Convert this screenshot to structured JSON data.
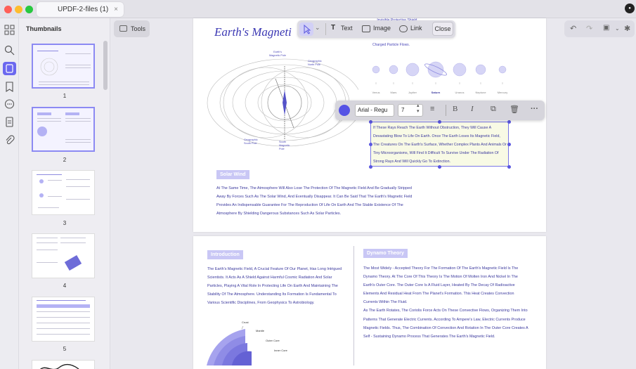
{
  "window": {
    "tab_title": "UPDF-2-files (1)",
    "tab_close": "×",
    "account_initial": "●"
  },
  "thumbnails": {
    "title": "Thumbnails",
    "pages": [
      "1",
      "2",
      "3",
      "4",
      "5"
    ]
  },
  "toolbar": {
    "tools_label": "Tools",
    "text_label": "Text",
    "image_label": "Image",
    "link_label": "Link",
    "close_label": "Close"
  },
  "format_bar": {
    "font": "Arial - Regu",
    "size": "7"
  },
  "page1": {
    "title": "Earth's Magneti",
    "planet_caption": "… Invisible Protective Shield,\nIt Effectively Resists Most\nSuch As High-Energy\nCharged Particle Flows.",
    "planets": [
      "Venus",
      "Mars",
      "Jupiter",
      "Saturn",
      "Uranus",
      "Neptune",
      "Mercury"
    ],
    "diagram_labels": {
      "north_mag": "Earth's\nMagnetic Pole",
      "geo_north": "Geographic\nNorth Pole",
      "geo_south": "Geographic\nSouth Pole",
      "south_mag": "South\nMagnetic\nPole"
    },
    "selected_text": "If These Rays Reach The Earth Without Obstruction, They Will Cause A Devastating Blow To Life On Earth. Once The Earth Loses Its Magnetic Field, The Creatures On The Earth's Surface, Whether Complex Plants And Animals Or Tiny Microorganisms, Will Find It Difficult To Survive Under The Radiation Of Strong Rays And Will Quickly Go To Extinction.",
    "solar_wind_tag": "Solar Wind",
    "solar_wind_text": "At The Same Time, The Atmosphere Will Also Lose The Protection Of The Magnetic Field And Be Gradually Stripped Away By Forces Such As The Solar Wind, And Eventually Disappear. It Can Be Said That The Earth's Magnetic Field Provides An Indispensable Guarantee For The Reproduction Of Life On Earth And The Stable Existence Of The Atmosphere By Shielding Dangerous Substances Such As Solar Particles."
  },
  "page2": {
    "intro_tag": "Introduction",
    "intro_text": "The Earth's Magnetic Field, A Crucial Feature Of Our Planet, Has Long Intrigued Scientists. It Acts As A Shield Against Harmful Cosmic Radiation And Solar Particles, Playing A Vital Role In Protecting Life On Earth And Maintaining The Stability Of The Atmosphere. Understanding Its Formation Is Fundamental To Various Scientific Disciplines, From Geophysics To Astrobiology.",
    "dynamo_tag": "Dynamo Theory",
    "dynamo_text": "The Most Widely - Accepted Theory For The Formation Of The Earth's Magnetic Field Is The Dynamo Theory. At The Core Of This Theory Is The Motion Of Molten Iron And Nickel In The Earth's Outer Core. The Outer Core Is A Fluid Layer, Heated By The Decay Of Radioactive Elements And Residual Heat From The Planet's Formation. This Heat Creates Convection Currents Within The Fluid.\nAs The Earth Rotates, The Coriolis Force Acts On These Convective Flows, Organizing Them Into Patterns That Generate Electric Currents. According To Ampere's Law, Electric Currents Produce Magnetic Fields. Thus, The Combination Of Convection And Rotation In The Outer Core Creates A Self - Sustaining Dynamo Process That Generates The Earth's Magnetic Field.",
    "layers": [
      "Crust",
      "Mantle",
      "Outer Core",
      "Inner Core"
    ]
  },
  "colors": {
    "accent": "#6b68ef",
    "text_blue": "#3c3a9e"
  }
}
